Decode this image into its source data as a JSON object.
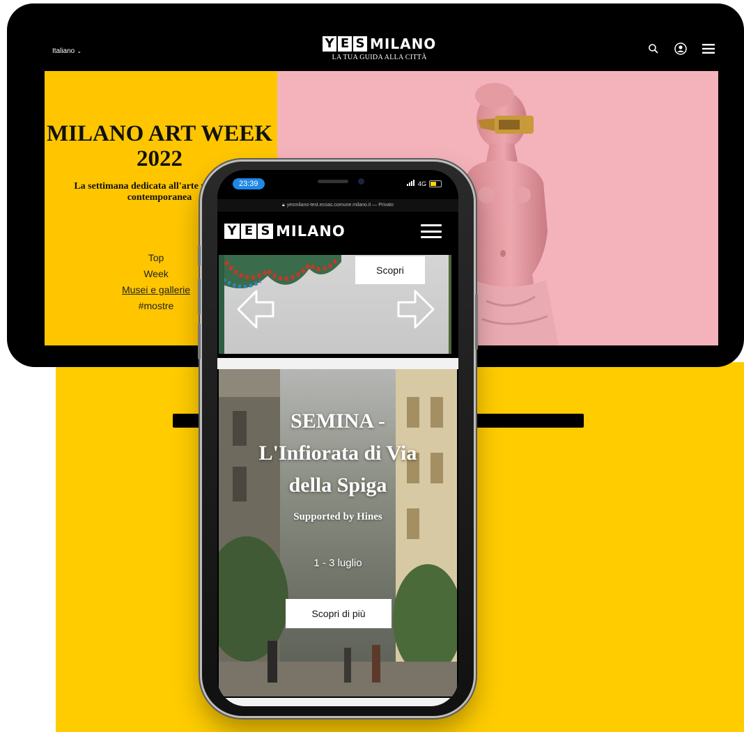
{
  "brand": {
    "yes_letters": [
      "Y",
      "E",
      "S"
    ],
    "word": "MILANO",
    "tagline": "LA TUA GUIDA ALLA CITTÀ"
  },
  "desktop": {
    "language": "Italiano",
    "icons": [
      "search-icon",
      "user-icon",
      "menu-icon"
    ],
    "title": "MILANO ART WEEK 2022",
    "subtitle": "La settimana dedicata all'arte moderna e contemporanea",
    "links": [
      "Top",
      "Week",
      "Musei e gallerie",
      "#mostre"
    ],
    "active_link": "Musei e gallerie"
  },
  "phone": {
    "status": {
      "time": "23:39",
      "signal": "4G"
    },
    "url": "yesmilano-test.ecoas.comune.milano.it — Privato",
    "carousel": {
      "button": "Scopri"
    },
    "hero": {
      "title": "SEMINA - L'Infiorata di Via della Spiga",
      "title_lines": [
        "SEMINA -",
        "L'Infiorata di Via",
        "della Spiga"
      ],
      "subtitle": "Supported by Hines",
      "date": "1 - 3 luglio",
      "button": "Scopri di più"
    }
  },
  "colors": {
    "yellow": "#FFCC00",
    "pink": "#F4B3BA",
    "black": "#000000",
    "time_pill": "#1E88E5"
  }
}
